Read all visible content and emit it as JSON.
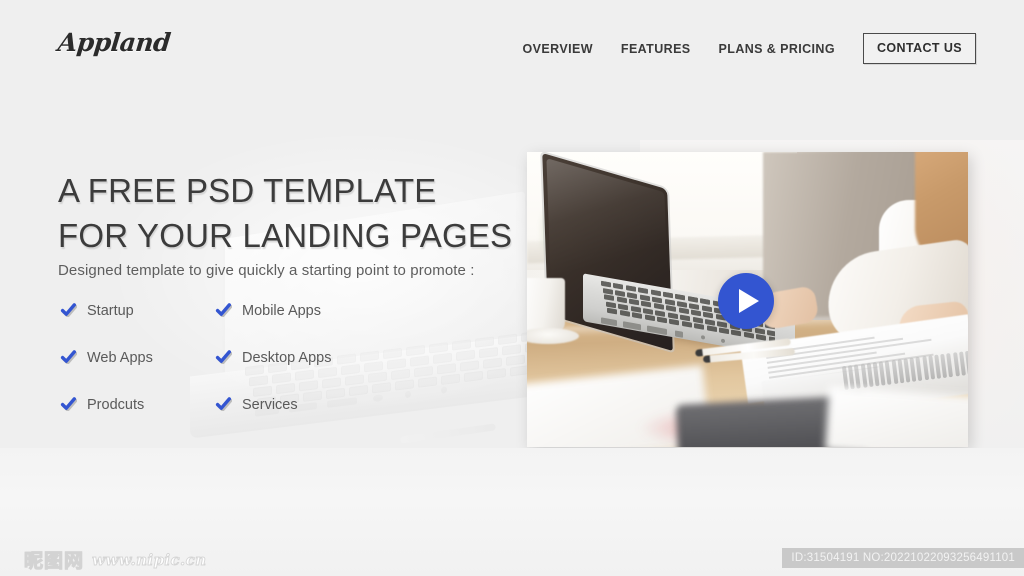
{
  "site": {
    "background_color": "#efefef",
    "logo_text": "Appland"
  },
  "nav": {
    "links": [
      {
        "label": "OVERVIEW"
      },
      {
        "label": "FEATURES"
      },
      {
        "label": "PLANS & PRICING"
      }
    ],
    "cta": {
      "label": "CONTACT US"
    }
  },
  "hero": {
    "headline_line1": "A FREE PSD TEMPLATE",
    "headline_line2": "FOR YOUR LANDING PAGES",
    "subtitle": "Designed template to give quickly a starting point to promote :",
    "check_color": "#3355d1",
    "features": [
      {
        "label": "Startup",
        "icon": "check-icon"
      },
      {
        "label": "Mobile Apps",
        "icon": "check-icon"
      },
      {
        "label": "Web Apps",
        "icon": "check-icon"
      },
      {
        "label": "Desktop Apps",
        "icon": "check-icon"
      },
      {
        "label": "Prodcuts",
        "icon": "check-icon"
      },
      {
        "label": "Services",
        "icon": "check-icon"
      }
    ]
  },
  "media": {
    "alt": "Woman working at a laptop on a wooden desk near a bright window",
    "play_button": {
      "icon": "play-icon",
      "color": "#3355d1"
    }
  },
  "footer": {
    "watermark_cn": "昵图网",
    "watermark_url": "www.nipic.cn",
    "id_text": "ID:31504191 NO:20221022093256491101"
  }
}
